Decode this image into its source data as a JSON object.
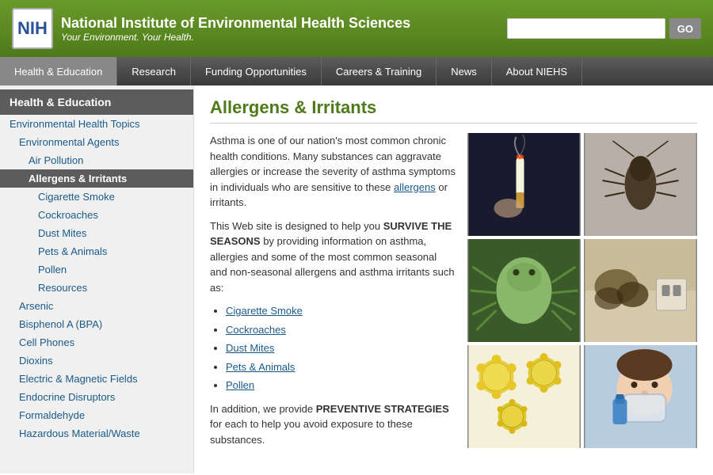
{
  "header": {
    "logo": "NIH",
    "title": "National Institute of Environmental Health Sciences",
    "subtitle": "Your Environment. Your Health.",
    "search_placeholder": "",
    "go_label": "GO"
  },
  "nav": {
    "items": [
      {
        "label": "Health & Education",
        "active": true
      },
      {
        "label": "Research",
        "active": false
      },
      {
        "label": "Funding Opportunities",
        "active": false
      },
      {
        "label": "Careers & Training",
        "active": false
      },
      {
        "label": "News",
        "active": false
      },
      {
        "label": "About NIEHS",
        "active": false
      }
    ]
  },
  "sidebar": {
    "header": "Health & Education",
    "items": [
      {
        "label": "Environmental Health Topics",
        "level": 1
      },
      {
        "label": "Environmental Agents",
        "level": 2
      },
      {
        "label": "Air Pollution",
        "level": 3
      },
      {
        "label": "Allergens & Irritants",
        "level": 3,
        "active": true
      },
      {
        "label": "Cigarette Smoke",
        "level": 4
      },
      {
        "label": "Cockroaches",
        "level": 4
      },
      {
        "label": "Dust Mites",
        "level": 4
      },
      {
        "label": "Pets & Animals",
        "level": 4
      },
      {
        "label": "Pollen",
        "level": 4
      },
      {
        "label": "Resources",
        "level": 4
      },
      {
        "label": "Arsenic",
        "level": 2
      },
      {
        "label": "Bisphenol A (BPA)",
        "level": 2
      },
      {
        "label": "Cell Phones",
        "level": 2
      },
      {
        "label": "Dioxins",
        "level": 2
      },
      {
        "label": "Electric & Magnetic Fields",
        "level": 2
      },
      {
        "label": "Endocrine Disruptors",
        "level": 2
      },
      {
        "label": "Formaldehyde",
        "level": 2
      },
      {
        "label": "Hazardous Material/Waste",
        "level": 2
      }
    ]
  },
  "content": {
    "title": "Allergens & Irritants",
    "intro1": "Asthma is one of our nation's most common chronic health conditions. Many substances can aggravate allergies or increase the severity of asthma symptoms in individuals who are sensitive to these ",
    "allergens_link": "allergens",
    "intro1_end": " or irritants.",
    "intro2_pre": "This Web site is designed to help you ",
    "intro2_bold": "SURVIVE THE SEASONS",
    "intro2_post": " by providing information on asthma, allergies and some of the most common seasonal and non-seasonal allergens and asthma irritants such as:",
    "list_items": [
      {
        "label": "Cigarette Smoke"
      },
      {
        "label": "Cockroaches"
      },
      {
        "label": "Dust Mites"
      },
      {
        "label": "Pets & Animals"
      },
      {
        "label": "Pollen"
      }
    ],
    "outro_pre": "In addition, we provide ",
    "outro_bold": "PREVENTIVE STRATEGIES",
    "outro_post": " for each to help you avoid exposure to these substances."
  },
  "images": [
    {
      "id": "cigarette",
      "alt": "Cigarette with smoke"
    },
    {
      "id": "cockroach",
      "alt": "Cockroach on wall"
    },
    {
      "id": "dustmite",
      "alt": "Dust mite microscopy"
    },
    {
      "id": "mold",
      "alt": "Mold on wall"
    },
    {
      "id": "pollen",
      "alt": "Pollen grains"
    },
    {
      "id": "child",
      "alt": "Child using inhaler"
    }
  ]
}
